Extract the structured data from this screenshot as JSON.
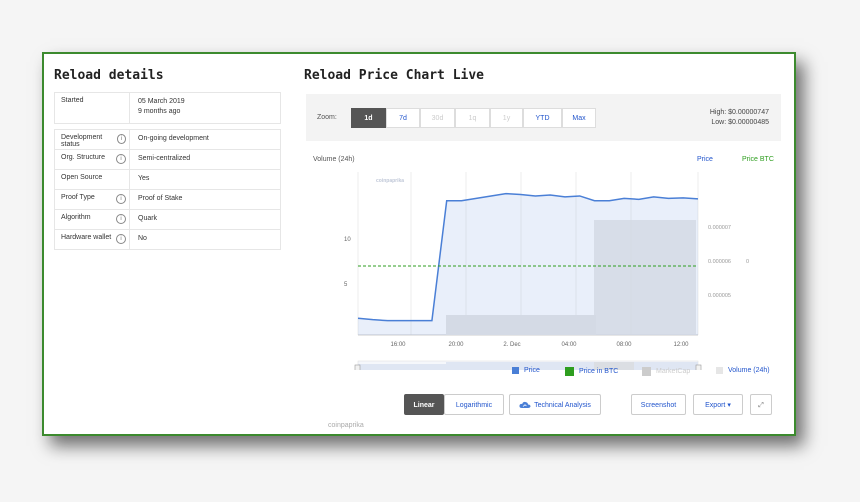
{
  "left_title": "Reload details",
  "right_title": "Reload Price Chart Live",
  "details": {
    "started_label": "Started",
    "started_value": "05 March 2019",
    "started_sub": "9 months ago",
    "rows": [
      {
        "label": "Development status",
        "info": true,
        "value": "On-going development"
      },
      {
        "label": "Org. Structure",
        "info": true,
        "value": "Semi-centralized"
      },
      {
        "label": "Open Source",
        "info": false,
        "value": "Yes"
      },
      {
        "label": "Proof Type",
        "info": true,
        "value": "Proof of Stake"
      },
      {
        "label": "Algorithm",
        "info": true,
        "value": "Quark"
      },
      {
        "label": "Hardware wallet",
        "info": true,
        "value": "No"
      }
    ]
  },
  "toolbar": {
    "zoom_label": "Zoom:",
    "zoom_buttons": [
      "1d",
      "7d",
      "30d",
      "1q",
      "1y",
      "YTD",
      "Max"
    ],
    "active_zoom": "1d",
    "high": "High: $0.00000747",
    "low": "Low: $0.00000485"
  },
  "legend_top": {
    "volume": "Volume (24h)",
    "price": "Price",
    "price_btc": "Price BTC"
  },
  "colors": {
    "price": "#4a7fd6",
    "price_btc": "#2e9e1f",
    "marketcap": "#cccccc",
    "volume": "#e0e0e0",
    "border": "#3c8a2e"
  },
  "chart_data": {
    "type": "line",
    "x": [
      "15:00",
      "16:00",
      "17:00",
      "18:00",
      "19:00",
      "19:45",
      "20:00",
      "21:00",
      "22:00",
      "23:00",
      "2. Dec",
      "01:00",
      "02:00",
      "03:00",
      "04:00",
      "05:00",
      "06:00",
      "07:00",
      "08:00",
      "09:00",
      "10:00",
      "11:00",
      "12:00",
      "12:45"
    ],
    "series": [
      {
        "name": "Price",
        "values": [
          4.85e-06,
          4.82e-06,
          4.8e-06,
          4.8e-06,
          4.8e-06,
          4.8e-06,
          7.3e-06,
          7.3e-06,
          7.35e-06,
          7.4e-06,
          7.45e-06,
          7.43e-06,
          7.4e-06,
          7.42e-06,
          7.38e-06,
          7.4e-06,
          7.3e-06,
          7.3e-06,
          7.35e-06,
          7.33e-06,
          7.38e-06,
          7.35e-06,
          7.36e-06,
          7.34e-06
        ]
      }
    ],
    "x_ticks": [
      "16:00",
      "20:00",
      "2. Dec",
      "04:00",
      "08:00",
      "12:00"
    ],
    "y_left_ticks": [
      "10",
      "5"
    ],
    "y_right_ticks": [
      "0.000007",
      "0.000006",
      "0.000005"
    ],
    "y_btc_tick": "0",
    "navigator_ticks": [
      "16:00",
      "2. Dec",
      "08:00"
    ],
    "watermark": "coinpaprika"
  },
  "bottom_legend": {
    "price": "Price",
    "price_btc": "Price in BTC",
    "marketcap": "MarketCap",
    "volume": "Volume (24h)"
  },
  "buttons": {
    "linear": "Linear",
    "log": "Logarithmic",
    "ta": "Technical Analysis",
    "screenshot": "Screenshot",
    "export": "Export"
  },
  "footer": "coinpaprika"
}
